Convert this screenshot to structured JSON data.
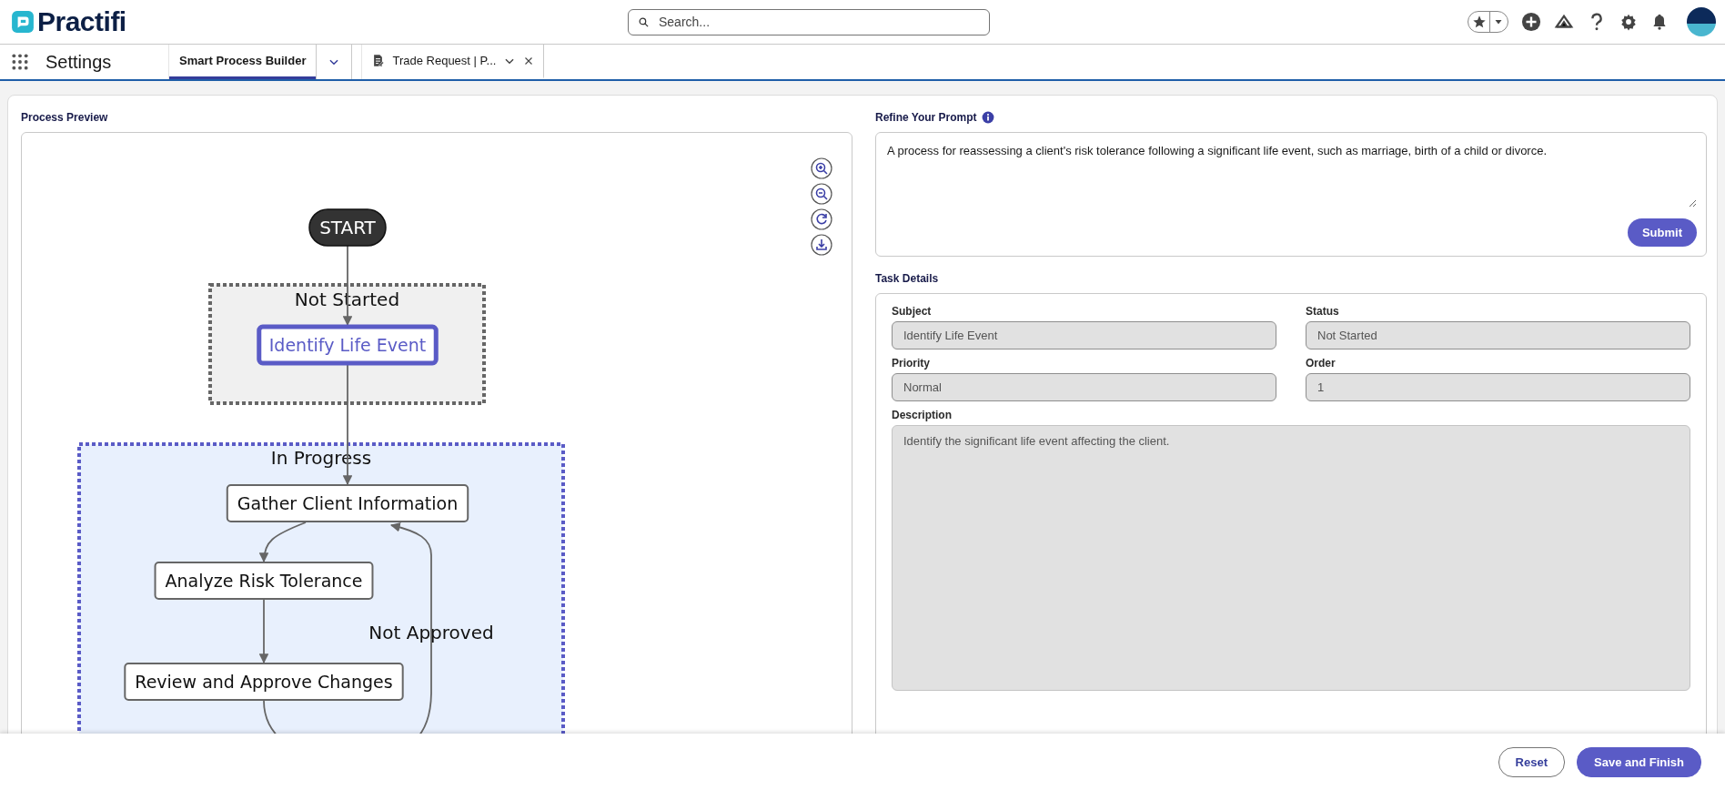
{
  "header": {
    "logo": "Practifi",
    "search": {
      "placeholder": "Search..."
    }
  },
  "nav": {
    "app_name": "Settings",
    "tabs": [
      {
        "label": "Smart Process Builder",
        "selected": true,
        "kind": "app"
      },
      {
        "label": "Trade Request | P...",
        "selected": false,
        "kind": "record"
      }
    ]
  },
  "process_preview": {
    "title": "Process Preview",
    "diagram": {
      "start": "START",
      "groups": [
        {
          "label": "Not Started",
          "kind": "not_started",
          "nodes": [
            {
              "label": "Identify Life Event",
              "selected": true
            }
          ]
        },
        {
          "label": "In Progress",
          "kind": "in_progress",
          "nodes": [
            {
              "label": "Gather Client Information",
              "selected": false
            },
            {
              "label": "Analyze Risk Tolerance",
              "selected": false
            },
            {
              "label": "Review and Approve Changes",
              "selected": false
            }
          ]
        }
      ],
      "edge_labels": [
        "Not Approved"
      ]
    }
  },
  "prompt": {
    "title": "Refine Your Prompt",
    "value": "A process for reassessing a client's risk tolerance following a significant life event, such as marriage, birth of a child or divorce.",
    "submit": "Submit"
  },
  "task_details": {
    "title": "Task Details",
    "fields": [
      {
        "label": "Subject",
        "value": "Identify Life Event"
      },
      {
        "label": "Status",
        "value": "Not Started"
      },
      {
        "label": "Priority",
        "value": "Normal"
      },
      {
        "label": "Order",
        "value": "1"
      }
    ],
    "description": {
      "label": "Description",
      "value": "Identify the significant life event affecting the client."
    }
  },
  "footer": {
    "buttons": [
      {
        "label": "Reset",
        "kind": "secondary"
      },
      {
        "label": "Save and Finish",
        "kind": "primary"
      }
    ]
  }
}
